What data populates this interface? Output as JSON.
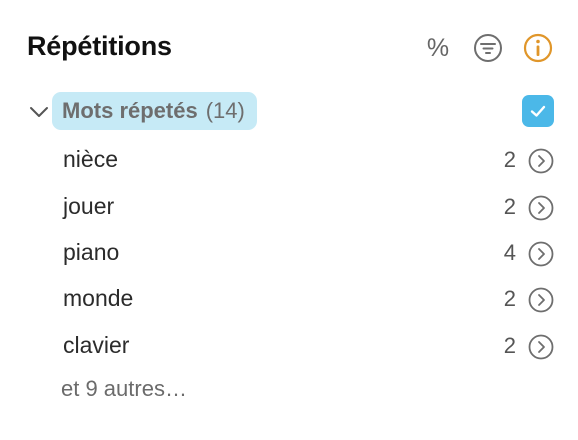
{
  "panel": {
    "title": "Répétitions",
    "percent_symbol": "%"
  },
  "icons": {
    "percent": "percent-icon",
    "filter": "filter-icon",
    "info": "info-icon",
    "chevron": "chevron-down-icon",
    "check": "checkmark-icon",
    "row_arrow": "chevron-right-circle-icon"
  },
  "colors": {
    "info_accent": "#e0962a",
    "pill_background": "#c6eaf6",
    "checkbox_fill": "#4bb8e8"
  },
  "group": {
    "label": "Mots répetés",
    "count": "(14)",
    "checked": true
  },
  "words": [
    {
      "label": "nièce",
      "count": "2"
    },
    {
      "label": "jouer",
      "count": "2"
    },
    {
      "label": "piano",
      "count": "4"
    },
    {
      "label": "monde",
      "count": "2"
    },
    {
      "label": "clavier",
      "count": "2"
    }
  ],
  "more": {
    "label": "et 9 autres…"
  }
}
